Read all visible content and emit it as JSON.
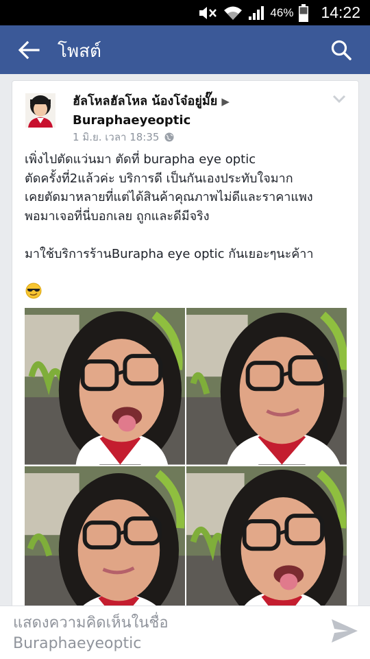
{
  "status_bar": {
    "battery_percent": "46%",
    "time": "14:22",
    "icons": [
      "mute-icon",
      "wifi-icon",
      "signal-icon",
      "battery-icon"
    ]
  },
  "app_bar": {
    "title": "โพสต์",
    "back_icon": "back-arrow-icon",
    "search_icon": "search-icon",
    "color": "#3b5998"
  },
  "post": {
    "author": "ฮัลโหลฮัลโหล น้องโจ๋อยู่มั๊ย",
    "arrow": "▶",
    "target": "Buraphaeyeoptic",
    "timestamp": "1 มิ.ย. เวลา 18:35",
    "privacy_icon": "globe-icon",
    "lines": [
      "เพิ่งไปตัดแว่นมา ตัดที่ burapha eye optic",
      "ตัดครั้งที่2แล้วค่ะ บริการดี เป็นกันเองประทับใจมาก",
      "เคยตัดมาหลายที่แต่ได้สินค้าคุณภาพไม่ดีและราคาแพง",
      "พอมาเจอที่นี่บอกเลย ถูกและดีมีจริง"
    ],
    "line2": "มาใช้บริการร้านBurapha eye optic กันเยอะๆนะค้าา",
    "emoji": "sunglasses-emoji"
  },
  "comment_bar": {
    "placeholder_line1": "แสดงความคิดเห็นในชื่อ",
    "placeholder_line2": "Buraphaeyeoptic",
    "send_icon": "send-icon"
  }
}
